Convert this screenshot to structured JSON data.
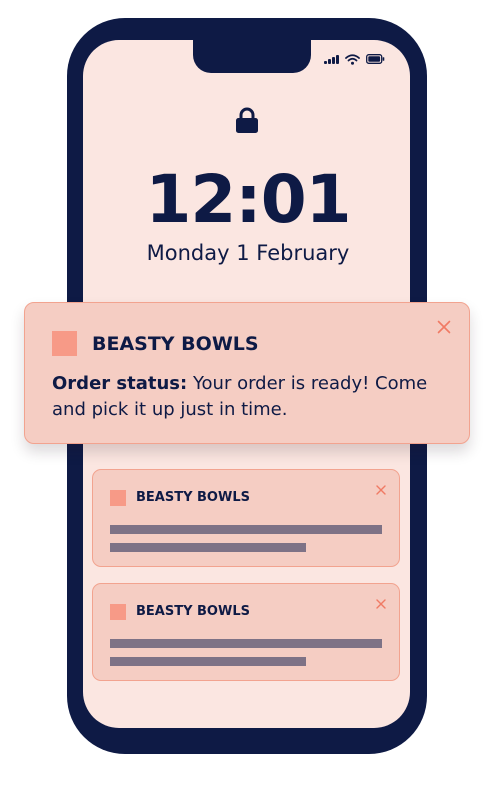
{
  "lock_screen": {
    "time": "12:01",
    "date": "Monday 1 February",
    "lock_icon": "lock-icon"
  },
  "status_bar": {
    "icons": [
      "cellular-signal-icon",
      "wifi-icon",
      "battery-icon"
    ]
  },
  "notifications": [
    {
      "app_name": "BEASTY BOWLS",
      "title": "Order status:",
      "message": " Your order is ready! Come and pick it up just in time.",
      "icon": "app-icon",
      "close_icon": "close-icon"
    },
    {
      "app_name": "BEASTY BOWLS",
      "icon": "app-icon",
      "close_icon": "close-icon"
    },
    {
      "app_name": "BEASTY BOWLS",
      "icon": "app-icon",
      "close_icon": "close-icon"
    }
  ],
  "colors": {
    "phone_frame": "#0e1a45",
    "screen_background": "#fbe6e1",
    "notification_background": "#f5cdc3",
    "notification_border": "#f2a38f",
    "app_icon": "#f79a87",
    "placeholder_text_bar": "#7e7286",
    "close_icon": "#f07a64"
  }
}
